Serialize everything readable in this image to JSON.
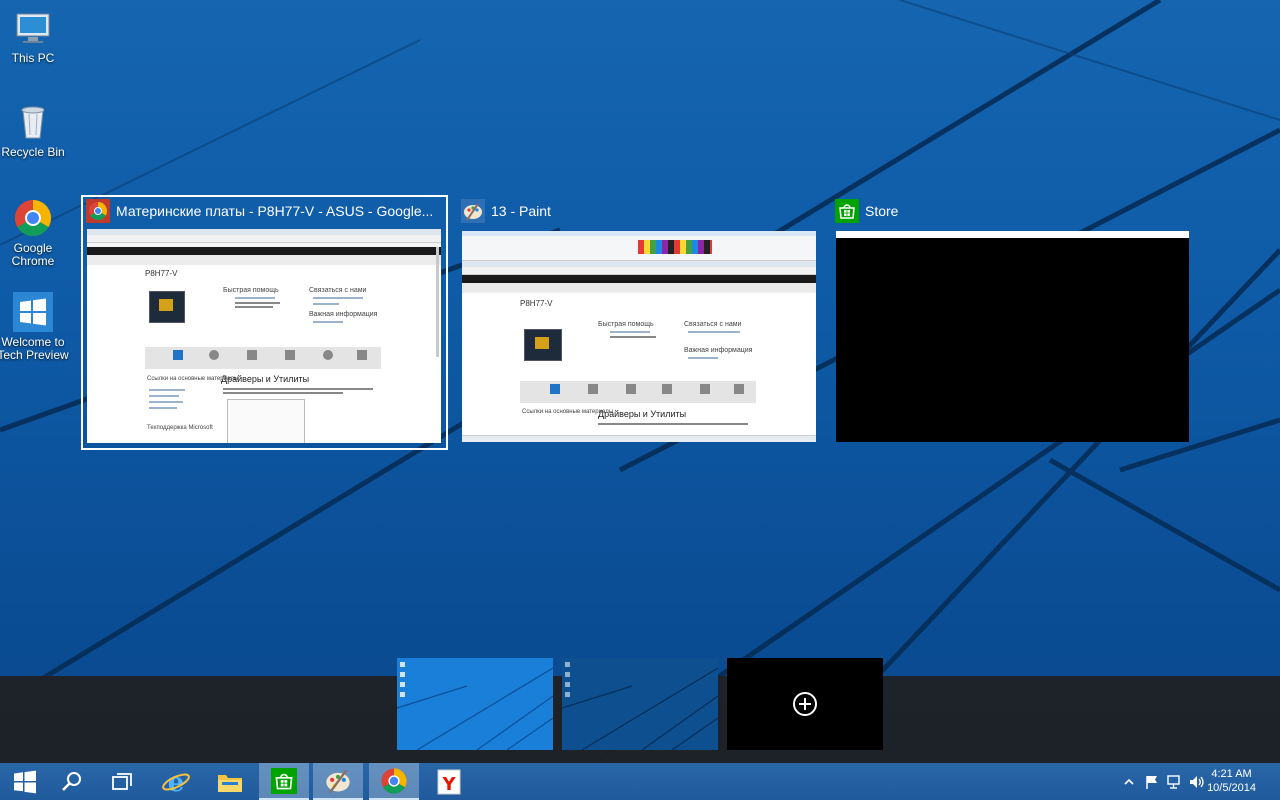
{
  "desktop": {
    "icons": [
      {
        "label_line1": "This PC",
        "label_line2": "",
        "icon": "computer-icon"
      },
      {
        "label_line1": "Recycle Bin",
        "label_line2": "",
        "icon": "recycle-bin-icon"
      },
      {
        "label_line1": "Google",
        "label_line2": "Chrome",
        "icon": "chrome-icon"
      },
      {
        "label_line1": "Welcome to",
        "label_line2": "Tech Preview",
        "icon": "windows-logo-icon"
      }
    ]
  },
  "task_view": {
    "windows": [
      {
        "title": "Материнские платы - P8H77-V - ASUS - Google...",
        "icon": "chrome-icon",
        "selected": true
      },
      {
        "title": "13 - Paint",
        "icon": "paint-icon",
        "selected": false
      },
      {
        "title": "Store",
        "icon": "store-icon",
        "selected": false
      }
    ],
    "page_preview": {
      "product": "P8H77-V",
      "heading": "Драйверы и Утилиты",
      "quick_help": "Быстрая помощь",
      "contact": "Связаться с нами",
      "important": "Важная информация",
      "links": "Ссылки на основные материалы",
      "tech": "Техподдержка Microsoft"
    },
    "add_desktop_icon": "plus-circle-icon"
  },
  "taskbar": {
    "buttons": [
      {
        "name": "start",
        "icon": "windows-logo-icon"
      },
      {
        "name": "search",
        "icon": "search-icon"
      },
      {
        "name": "task-view",
        "icon": "task-view-icon"
      },
      {
        "name": "internet-explorer",
        "icon": "ie-icon"
      },
      {
        "name": "file-explorer",
        "icon": "folder-icon"
      },
      {
        "name": "store",
        "icon": "store-icon"
      },
      {
        "name": "paint",
        "icon": "paint-icon"
      },
      {
        "name": "chrome",
        "icon": "chrome-icon"
      },
      {
        "name": "yandex",
        "icon": "yandex-icon"
      }
    ],
    "tray_icons": [
      "chevron-up-icon",
      "flag-icon",
      "network-icon",
      "volume-icon"
    ],
    "time": "4:21 AM",
    "date": "10/5/2014"
  },
  "colors": {
    "wallpaper": "#0e5aa6",
    "taskbar": "#2566a8",
    "selection": "#ffffff",
    "store_green": "#00a300"
  }
}
